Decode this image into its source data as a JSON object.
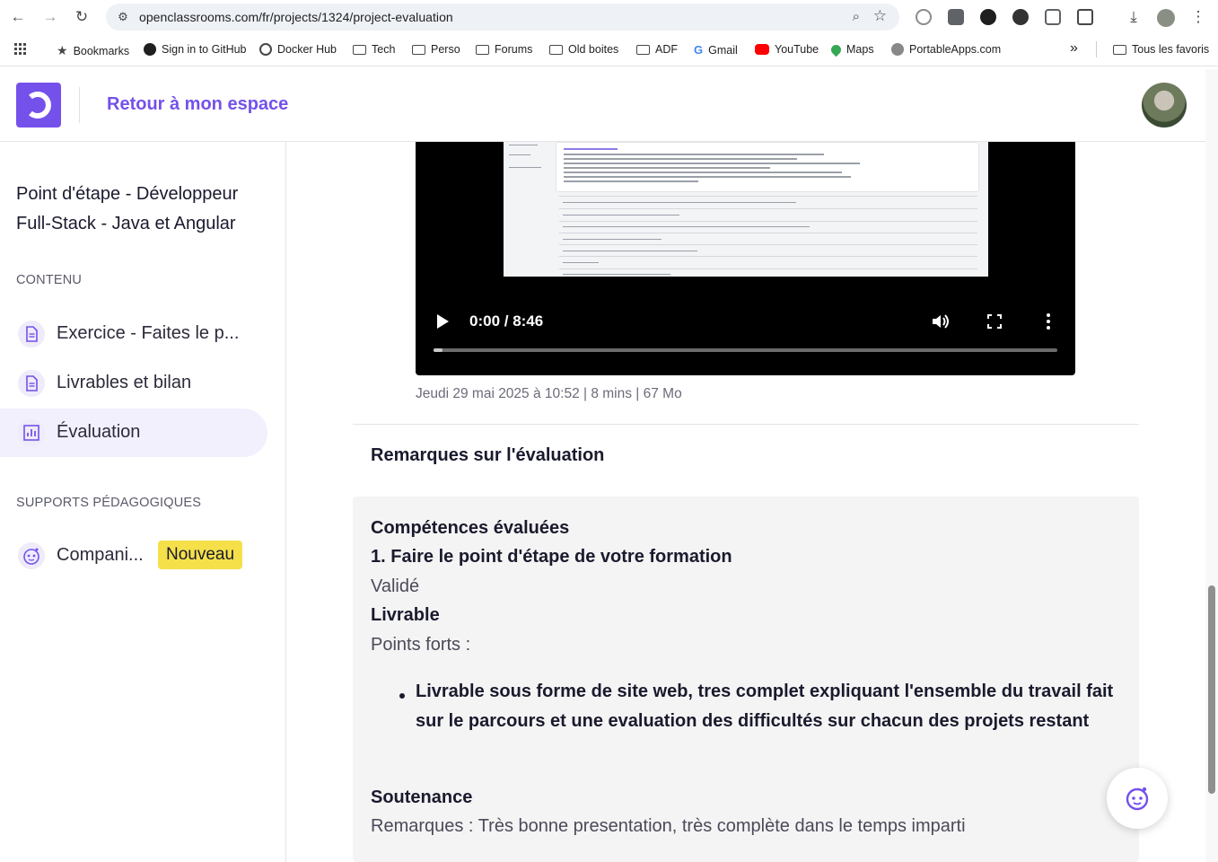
{
  "browser": {
    "url": "openclassrooms.com/fr/projects/1324/project-evaluation",
    "bookmarks": [
      {
        "label": "Bookmarks",
        "icon": "star-icon"
      },
      {
        "label": "Sign in to GitHub",
        "icon": "github-icon"
      },
      {
        "label": "Docker Hub",
        "icon": "docker-icon"
      },
      {
        "label": "Tech",
        "icon": "folder-icon"
      },
      {
        "label": "Perso",
        "icon": "folder-icon"
      },
      {
        "label": "Forums",
        "icon": "folder-icon"
      },
      {
        "label": "Old boites",
        "icon": "folder-icon"
      },
      {
        "label": "ADF",
        "icon": "folder-icon"
      },
      {
        "label": "Gmail",
        "icon": "google-icon"
      },
      {
        "label": "YouTube",
        "icon": "youtube-icon"
      },
      {
        "label": "Maps",
        "icon": "maps-icon"
      },
      {
        "label": "PortableApps.com",
        "icon": "portableapps-icon"
      }
    ],
    "overflow": "»",
    "all_bookmarks": "Tous les favoris"
  },
  "header": {
    "back_label": "Retour à mon espace",
    "brand_color": "#7451eb"
  },
  "sidebar": {
    "course_title": "Point d'étape - Développeur Full-Stack - Java et Angular",
    "content_label": "CONTENU",
    "items": [
      {
        "label": "Exercice - Faites le p...",
        "icon": "document-icon"
      },
      {
        "label": "Livrables et bilan",
        "icon": "document-icon"
      },
      {
        "label": "Évaluation",
        "icon": "chart-icon",
        "active": true
      }
    ],
    "supports_label": "SUPPORTS PÉDAGOGIQUES",
    "companion": {
      "label": "Compani...",
      "icon": "robot-face-icon",
      "badge": "Nouveau"
    }
  },
  "video": {
    "time": "0:00 / 8:46",
    "progress": 0.0,
    "meta": "Jeudi 29 mai 2025 à 10:52 | 8 mins | 67 Mo"
  },
  "remarks": {
    "title": "Remarques sur l'évaluation",
    "competences_title": "Compétences évaluées",
    "competence_1": "1. Faire le point d'étape de votre formation",
    "competence_1_status": "Validé",
    "livrable_title": "Livrable",
    "strengths_label": "Points forts :",
    "strengths": [
      "Livrable sous forme de site web, tres complet expliquant l'ensemble du travail fait sur le parcours et une evaluation des difficultés sur chacun des projets restant"
    ],
    "soutenance_title": "Soutenance",
    "soutenance_text": "Remarques : Très bonne presentation, très complète dans le temps imparti"
  }
}
